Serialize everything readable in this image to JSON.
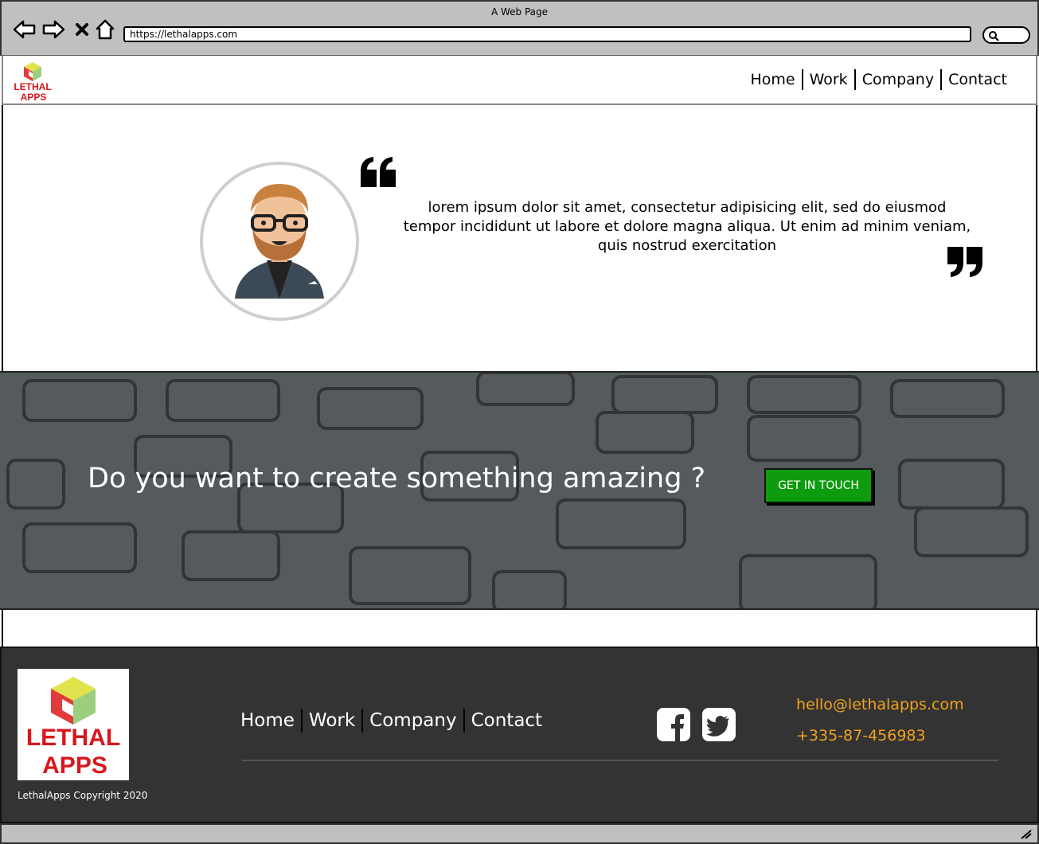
{
  "browser": {
    "window_title": "A Web Page",
    "url": "https://lethalapps.com"
  },
  "header": {
    "logo_alt": "LETHAL APPS",
    "nav": [
      "Home",
      "Work",
      "Company",
      "Contact"
    ]
  },
  "testimonial": {
    "quote": "lorem ipsum dolor sit amet, consectetur adipisicing elit, sed do eiusmod tempor incididunt ut labore et dolore magna aliqua. Ut enim ad minim veniam, quis nostrud exercitation"
  },
  "cta": {
    "headline": "Do you want to create something amazing ?",
    "button_label": "GET IN TOUCH"
  },
  "footer": {
    "logo_alt": "LETHAL APPS",
    "copyright": "LethalApps Copyright 2020",
    "nav": [
      "Home",
      "Work",
      "Company",
      "Contact"
    ],
    "social": [
      "facebook-icon",
      "twitter-icon"
    ],
    "email": "hello@lethalapps.com",
    "phone": "+335-87-456983"
  },
  "colors": {
    "accent_green": "#0e9b0e",
    "contact_orange": "#f0a21e",
    "footer_bg": "#333333"
  }
}
